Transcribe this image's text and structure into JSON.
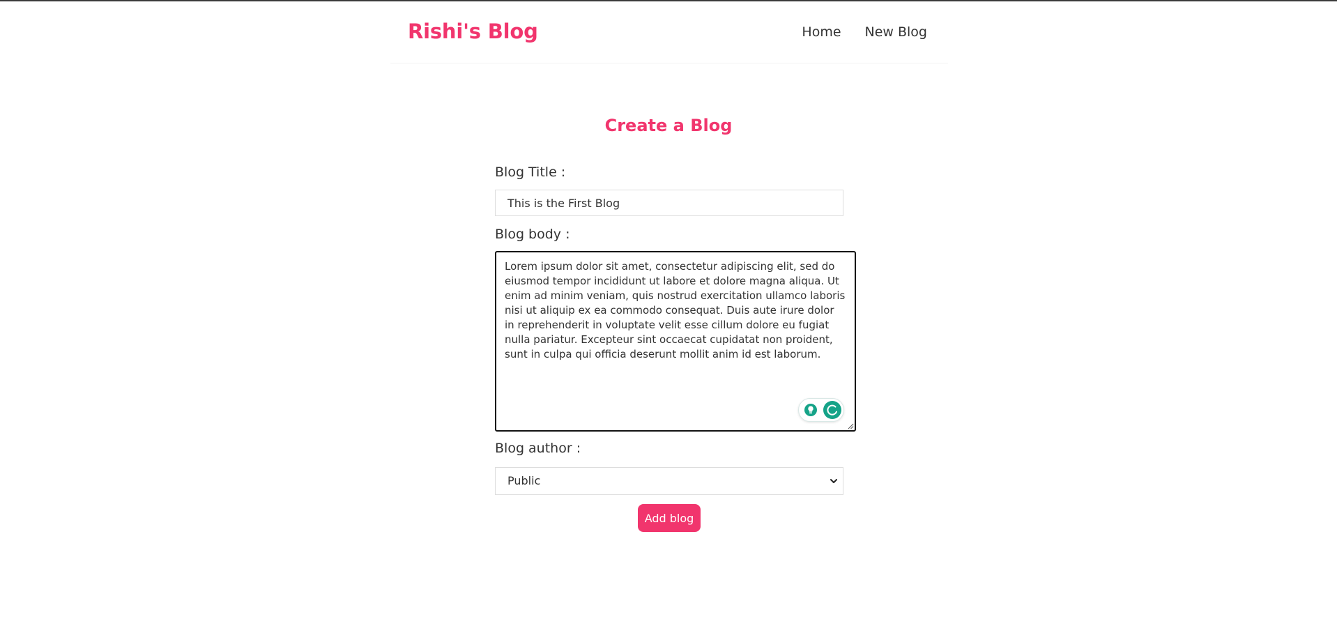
{
  "navbar": {
    "brand": "Rishi's Blog",
    "links": [
      {
        "label": "Home"
      },
      {
        "label": "New Blog"
      }
    ]
  },
  "create": {
    "title": "Create a Blog",
    "title_label": "Blog Title :",
    "title_value": "This is the First Blog",
    "body_label": "Blog body :",
    "body_value": "Lorem ipsum dolor sit amet, consectetur adipiscing elit, sed do eiusmod tempor incididunt ut labore et dolore magna aliqua. Ut enim ad minim veniam, quis nostrud exercitation ullamco laboris nisi ut aliquip ex ea commodo consequat. Duis aute irure dolor in reprehenderit in voluptate velit esse cillum dolore eu fugiat nulla pariatur. Excepteur sint occaecat cupidatat non proident, sunt in culpa qui officia deserunt mollit anim id est laborum.",
    "author_label": "Blog author :",
    "author_value": "Public",
    "submit_label": "Add blog"
  },
  "colors": {
    "accent": "#f1356d",
    "assistant": "#15a388",
    "text": "#333333"
  },
  "icons": {
    "assist": [
      "lightbulb-icon",
      "writing-assistant-icon"
    ],
    "select": "chevron-down-icon",
    "textarea": "resize-handle-icon"
  }
}
